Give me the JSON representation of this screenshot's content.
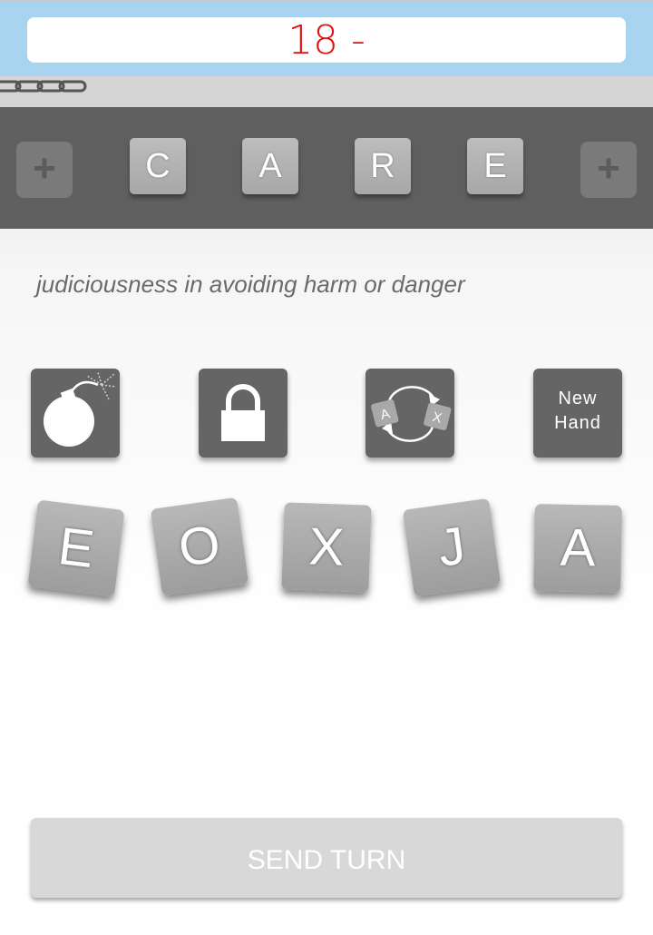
{
  "header": {
    "score_text": "18 -"
  },
  "word": {
    "add_left": "+",
    "add_right": "+",
    "tiles": [
      "C",
      "A",
      "R",
      "E"
    ]
  },
  "definition": "judiciousness in avoiding harm or danger",
  "powerups": {
    "bomb_icon": "bomb-icon",
    "lock_icon": "lock-icon",
    "swap_icon": "swap-icon",
    "swap_tiles": [
      "A",
      "X"
    ],
    "new_hand_line1": "New",
    "new_hand_line2": "Hand"
  },
  "hand": {
    "tiles": [
      "E",
      "O",
      "X",
      "J",
      "A"
    ]
  },
  "send_button": "SEND TURN",
  "colors": {
    "score": "#e01010",
    "header_bg": "#a9d4f0",
    "word_band": "#5f5f5f",
    "tile": "#b0b0b0",
    "powerup": "#656565",
    "send_button": "#d8d8d8"
  }
}
